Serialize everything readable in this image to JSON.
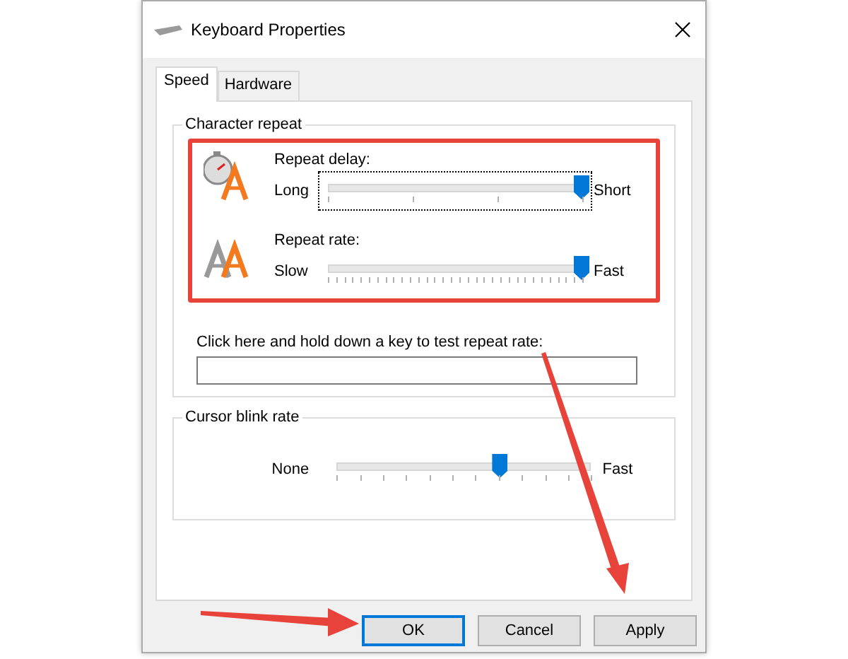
{
  "window": {
    "title": "Keyboard Properties"
  },
  "tabs": [
    {
      "label": "Speed",
      "selected": true
    },
    {
      "label": "Hardware",
      "selected": false
    }
  ],
  "character_repeat": {
    "title": "Character repeat",
    "sliders": [
      {
        "kind": "delay",
        "label": "Repeat delay:",
        "min_label": "Long",
        "max_label": "Short",
        "level": 1,
        "focused": true
      },
      {
        "kind": "rate",
        "label": "Repeat rate:",
        "min_label": "Slow",
        "max_label": "Fast",
        "level": 1,
        "focused": false
      }
    ],
    "test_label": "Click here and hold down a key to test repeat rate:"
  },
  "cursor_blink": {
    "title": "Cursor blink rate",
    "min_label": "None",
    "max_label": "Fast",
    "level": 0.64
  },
  "buttons": [
    {
      "label": "OK",
      "default": true
    },
    {
      "label": "Cancel",
      "default": false
    },
    {
      "label": "Apply",
      "default": false
    }
  ]
}
